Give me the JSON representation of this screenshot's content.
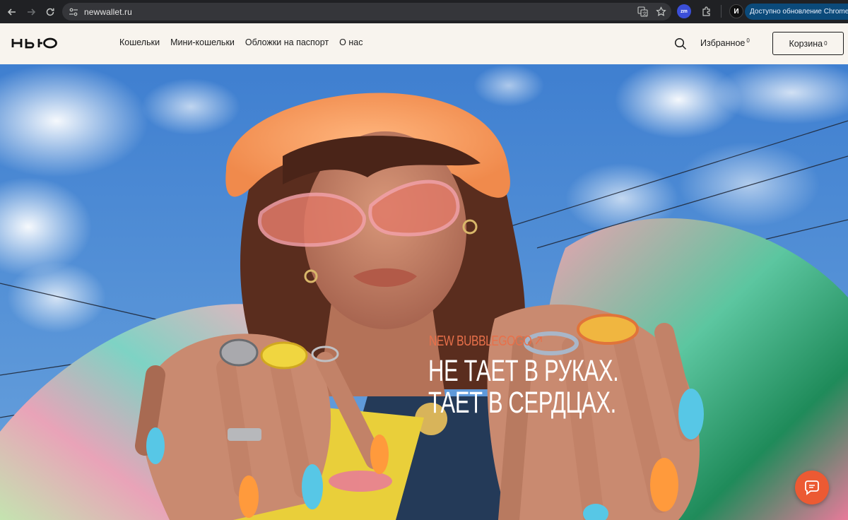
{
  "browser": {
    "url": "newwallet.ru",
    "update_label": "Доступно обновление Chrome",
    "profile_initial": "И",
    "extension_label": "zm"
  },
  "header": {
    "logo_text": "НЬЮ",
    "nav": [
      {
        "label": "Кошельки"
      },
      {
        "label": "Мини-кошельки"
      },
      {
        "label": "Обложки на паспорт"
      },
      {
        "label": "О нас"
      }
    ],
    "favorites_label": "Избранное",
    "favorites_count": "0",
    "cart_label": "Корзина",
    "cart_count": "0"
  },
  "hero": {
    "eyebrow": "NEW BUBBLEGOGO",
    "title_line1": "НЕ ТАЕТ В РУКАХ.",
    "title_line2": "ТАЕТ В СЕРДЦАХ."
  },
  "colors": {
    "header_bg": "#f8f4ee",
    "accent": "#ec5a33",
    "eyebrow": "#e8704a",
    "sky": "#4b86cc"
  },
  "icons": {
    "back": "arrow-left-icon",
    "forward": "arrow-right-icon",
    "reload": "reload-icon",
    "search": "search-icon",
    "chat": "chat-icon"
  }
}
